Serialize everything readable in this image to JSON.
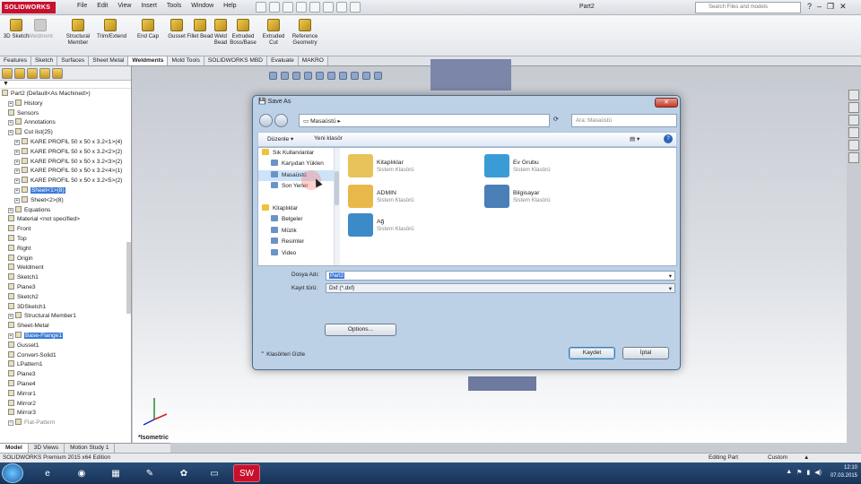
{
  "app": {
    "logo": "SOLIDWORKS",
    "doc_title": "Part2",
    "search_placeholder": "Search Files and models"
  },
  "menu": [
    "File",
    "Edit",
    "View",
    "Insert",
    "Tools",
    "Window",
    "Help"
  ],
  "ribbon": [
    {
      "label": "3D Sketch",
      "disabled": false
    },
    {
      "label": "Weldment",
      "disabled": true
    },
    {
      "label": "Structural Member",
      "disabled": false
    },
    {
      "label": "Trim/Extend",
      "disabled": false
    },
    {
      "label": "End Cap",
      "disabled": false
    },
    {
      "label": "Gusset",
      "disabled": false
    },
    {
      "label": "Fillet Bead",
      "disabled": false
    },
    {
      "label": "Weld Bead",
      "disabled": false
    },
    {
      "label": "Extruded Boss/Base",
      "disabled": false
    },
    {
      "label": "Extruded Cut",
      "disabled": false
    },
    {
      "label": "Reference Geometry",
      "disabled": false
    }
  ],
  "tabs": [
    {
      "label": "Features",
      "active": false
    },
    {
      "label": "Sketch",
      "active": false
    },
    {
      "label": "Surfaces",
      "active": false
    },
    {
      "label": "Sheet Metal",
      "active": false
    },
    {
      "label": "Weldments",
      "active": true
    },
    {
      "label": "Mold Tools",
      "active": false
    },
    {
      "label": "SOLIDWORKS MBD",
      "active": false
    },
    {
      "label": "Evaluate",
      "active": false
    },
    {
      "label": "MAKRO",
      "active": false
    }
  ],
  "tree": [
    {
      "label": "Part2  (Default<As Machined>)",
      "indent": 0,
      "expand": false
    },
    {
      "label": "History",
      "indent": 1,
      "expand": true
    },
    {
      "label": "Sensors",
      "indent": 1,
      "expand": false
    },
    {
      "label": "Annotations",
      "indent": 1,
      "expand": true
    },
    {
      "label": "Cut list(25)",
      "indent": 1,
      "expand": true
    },
    {
      "label": "KARE PROFIL 50 x 50 x 3.2<1>(4)",
      "indent": 2,
      "expand": true
    },
    {
      "label": "KARE PROFIL 50 x 50 x 3.2<2>(2)",
      "indent": 2,
      "expand": true
    },
    {
      "label": "KARE PROFIL 50 x 50 x 3.2<3>(2)",
      "indent": 2,
      "expand": true
    },
    {
      "label": "KARE PROFIL 50 x 50 x 3.2<4>(1)",
      "indent": 2,
      "expand": true
    },
    {
      "label": "KARE PROFIL 50 x 50 x 3.2<5>(2)",
      "indent": 2,
      "expand": true
    },
    {
      "label": "Sheet<1>(8)",
      "indent": 2,
      "expand": true,
      "selected": true
    },
    {
      "label": "Sheet<2>(8)",
      "indent": 2,
      "expand": true
    },
    {
      "label": "Equations",
      "indent": 1,
      "expand": true
    },
    {
      "label": "Material <not specified>",
      "indent": 1,
      "expand": false
    },
    {
      "label": "Front",
      "indent": 1,
      "expand": false
    },
    {
      "label": "Top",
      "indent": 1,
      "expand": false
    },
    {
      "label": "Right",
      "indent": 1,
      "expand": false
    },
    {
      "label": "Origin",
      "indent": 1,
      "expand": false
    },
    {
      "label": "Weldment",
      "indent": 1,
      "expand": false
    },
    {
      "label": "Sketch1",
      "indent": 1,
      "expand": false
    },
    {
      "label": "Plane3",
      "indent": 1,
      "expand": false
    },
    {
      "label": "Sketch2",
      "indent": 1,
      "expand": false
    },
    {
      "label": "3DSketch1",
      "indent": 1,
      "expand": false
    },
    {
      "label": "Structural Member1",
      "indent": 1,
      "expand": true
    },
    {
      "label": "Sheet-Metal",
      "indent": 1,
      "expand": false
    },
    {
      "label": "Base-Flange1",
      "indent": 1,
      "expand": true,
      "selected": true
    },
    {
      "label": "Gusset1",
      "indent": 1,
      "expand": false
    },
    {
      "label": "Convert-Solid1",
      "indent": 1,
      "expand": false
    },
    {
      "label": "LPattern1",
      "indent": 1,
      "expand": false
    },
    {
      "label": "Plane3",
      "indent": 1,
      "expand": false
    },
    {
      "label": "Plane4",
      "indent": 1,
      "expand": false
    },
    {
      "label": "Mirror1",
      "indent": 1,
      "expand": false
    },
    {
      "label": "Mirror2",
      "indent": 1,
      "expand": false
    },
    {
      "label": "Mirror3",
      "indent": 1,
      "expand": false
    },
    {
      "label": "Flat-Pattern",
      "indent": 1,
      "expand": true,
      "dim": true
    }
  ],
  "bottom_tabs": [
    {
      "label": "Model",
      "active": true
    },
    {
      "label": "3D Views",
      "active": false
    },
    {
      "label": "Motion Study 1",
      "active": false
    }
  ],
  "viewport": {
    "view_label": "*Isometric"
  },
  "status": {
    "left": "SOLIDWORKS Premium 2015 x64 Edition",
    "mode": "Editing Part",
    "units": "Custom"
  },
  "clock": {
    "time": "12:10",
    "date": "07.03.2015"
  },
  "dialog": {
    "title": "Save As",
    "address": "Masaüstü",
    "search_placeholder": "Ara: Masaüstü",
    "organize": "Düzenle",
    "new_folder": "Yeni klasör",
    "nav": [
      {
        "label": "Sık Kullanılanlar",
        "group": true
      },
      {
        "label": "Karşıdan Yüklen",
        "group": false
      },
      {
        "label": "Masaüstü",
        "group": false,
        "selected": true
      },
      {
        "label": "Son Yerler",
        "group": false
      },
      {
        "label": "",
        "group": false
      },
      {
        "label": "Kitaplıklar",
        "group": true
      },
      {
        "label": "Belgeler",
        "group": false
      },
      {
        "label": "Müzik",
        "group": false
      },
      {
        "label": "Resimler",
        "group": false
      },
      {
        "label": "Video",
        "group": false
      }
    ],
    "files": [
      {
        "name": "Kitaplıklar",
        "type": "Sistem Klasörü",
        "color": "#e8c25a"
      },
      {
        "name": "Ev Grubu",
        "type": "Sistem Klasörü",
        "color": "#3b9bd6"
      },
      {
        "name": "ADMIN",
        "type": "Sistem Klasörü",
        "color": "#e8b84a"
      },
      {
        "name": "Bilgisayar",
        "type": "Sistem Klasörü",
        "color": "#4a7fb8"
      },
      {
        "name": "Ağ",
        "type": "Sistem Klasörü",
        "color": "#3d8ac9"
      }
    ],
    "file_name_label": "Dosya Adı:",
    "file_name": "Part2",
    "file_type_label": "Kayıt türü:",
    "file_type": "Dxf (*.dxf)",
    "options": "Options...",
    "hide_folders": "Klasörleri Gizle",
    "save": "Kaydet",
    "cancel": "İptal"
  }
}
